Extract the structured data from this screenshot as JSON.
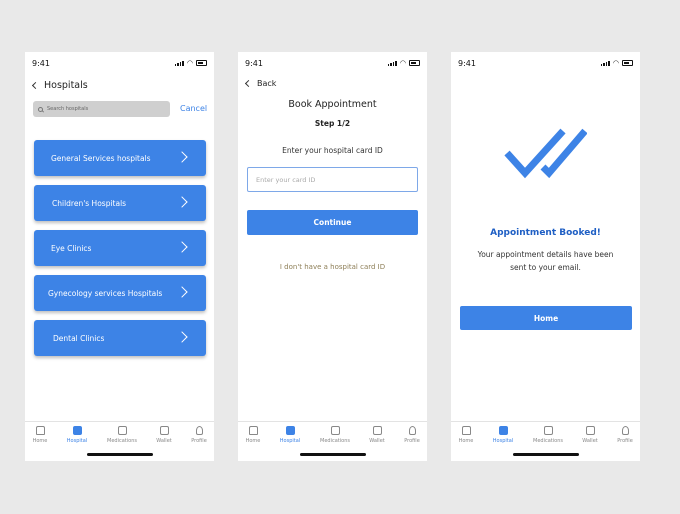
{
  "status_time": "9:41",
  "colors": {
    "accent": "#3d83e6",
    "booked_title": "#1f5fc4",
    "link": "#8e7f58"
  },
  "nav": [
    {
      "label": "Home",
      "icon": "home-icon"
    },
    {
      "label": "Hospital",
      "icon": "hospital-icon"
    },
    {
      "label": "Medications",
      "icon": "medications-icon"
    },
    {
      "label": "Wallet",
      "icon": "wallet-icon"
    },
    {
      "label": "Profile",
      "icon": "profile-icon"
    }
  ],
  "screen1": {
    "title": "Hospitals",
    "search_placeholder": "Search hospitals",
    "cancel_label": "Cancel",
    "items": [
      {
        "label": "General Services hospitals"
      },
      {
        "label": "Children's Hospitals"
      },
      {
        "label": "Eye Clinics"
      },
      {
        "label": "Gynecology services Hospitals"
      },
      {
        "label": "Dental Clinics"
      }
    ]
  },
  "screen2": {
    "back_label": "Back",
    "title": "Book Appointment",
    "step": "Step 1/2",
    "prompt": "Enter your hospital card ID",
    "input_placeholder": "Enter your card ID",
    "continue_label": "Continue",
    "no_card_link": "I don't have a hospital card ID"
  },
  "screen3": {
    "icon": "double-check-icon",
    "title": "Appointment Booked!",
    "message": "Your appointment details have been sent to your email.",
    "home_label": "Home"
  }
}
